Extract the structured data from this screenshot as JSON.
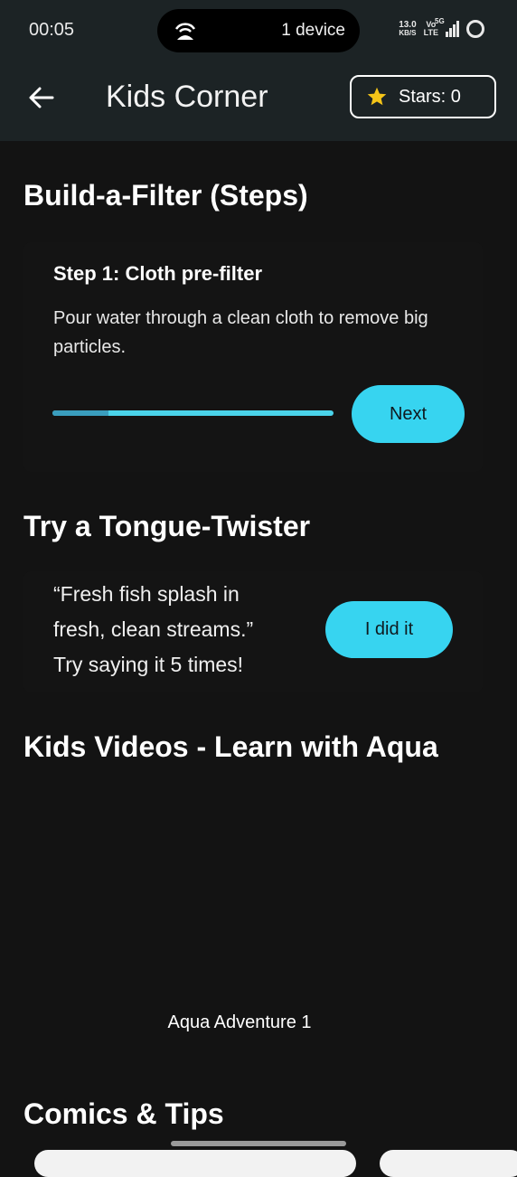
{
  "status_bar": {
    "time": "00:05",
    "hotspot_devices": "1 device",
    "net_speed_value": "13.0",
    "net_speed_unit": "KB/S",
    "volte_top": "Vo",
    "volte_bottom": "LTE",
    "network": "5G",
    "icons": [
      "hotspot-icon",
      "signal-icon",
      "battery-ring-icon"
    ]
  },
  "app_bar": {
    "title": "Kids Corner",
    "back_icon": "arrow-left-icon",
    "stars_label": "Stars: 0",
    "star_icon_color": "#f5c518"
  },
  "filter": {
    "heading": "Build-a-Filter (Steps)",
    "step_title": "Step 1: Cloth pre-filter",
    "step_description": "Pour water through a clean cloth to remove big particles.",
    "progress": 0.2,
    "next_label": "Next"
  },
  "twister": {
    "heading": "Try a Tongue-Twister",
    "line1": "“Fresh fish splash in",
    "line2": "fresh, clean streams.”",
    "line3": "Try saying it 5 times!",
    "button_label": "I did it"
  },
  "videos": {
    "heading": "Kids Videos - Learn with Aqua",
    "caption": "Aqua Adventure 1"
  },
  "comics": {
    "heading": "Comics & Tips"
  },
  "colors": {
    "background": "#131313",
    "appbar": "#1c2325",
    "accent": "#37d4f0"
  }
}
